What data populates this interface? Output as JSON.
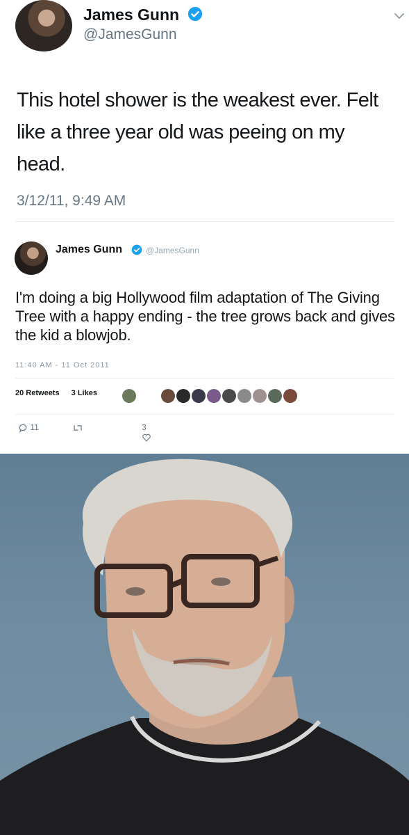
{
  "tweet1": {
    "name": "James Gunn",
    "handle": "@JamesGunn",
    "text": "This hotel shower is the weakest ever. Felt like a three year old was peeing on my head.",
    "timestamp": "3/12/11, 9:49 AM",
    "icons": {
      "verified": "verified-badge-icon",
      "menu": "chevron-down-icon"
    }
  },
  "tweet2": {
    "name": "James Gunn",
    "handle": "@JamesGunn",
    "text": "I'm doing a big Hollywood film adaptation of The Giving Tree with a happy ending - the tree grows back and gives the kid a blowjob.",
    "timestamp": "11:40 AM - 11 Oct 2011",
    "retweets": "20 Retweets",
    "likes": "3 Likes",
    "actions": {
      "reply_count": "11",
      "retweet_count": "",
      "like_count": "3"
    }
  },
  "photo": {
    "subject": "portrait-photo"
  },
  "colors": {
    "verified": "#1da1f2",
    "text": "#14171a",
    "secondary": "#657786"
  }
}
